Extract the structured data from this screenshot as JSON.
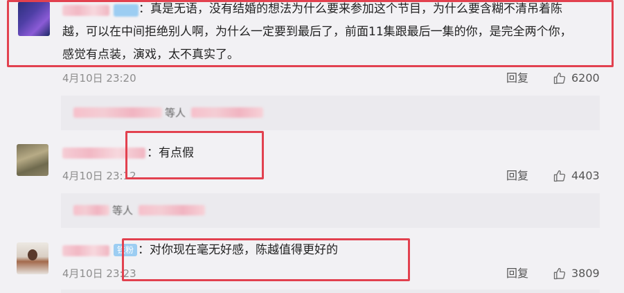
{
  "comments": [
    {
      "text_lines": [
        "：真是无语，没有结婚的想法为什么要来参加这个节目，为什么要含糊不清吊着陈",
        "越，可以在中间拒绝别人啊，为什么一定要到最后了，前面11集跟最后一集的你，是完全两个你，",
        "感觉有点装，演戏，太不真实了。"
      ],
      "time": "4月10日 23:20",
      "reply_label": "回复",
      "likes": "6200"
    },
    {
      "text": "：有点假",
      "time": "4月10日 23:12",
      "reply_label": "回复",
      "likes": "4403"
    },
    {
      "badge": "铁粉",
      "text": "：对你现在毫无好感，陈越值得更好的",
      "time": "4月10日 23:23",
      "reply_label": "回复",
      "likes": "3809"
    }
  ],
  "sub_replies": [
    {
      "middle_text": "等人"
    },
    {
      "middle_text": "等人"
    }
  ],
  "colors": {
    "highlight_box": "#e2414f",
    "badge": "#9ccdf2",
    "background": "#f2f1f4"
  },
  "icons": {
    "like": "thumbs-up-icon"
  }
}
